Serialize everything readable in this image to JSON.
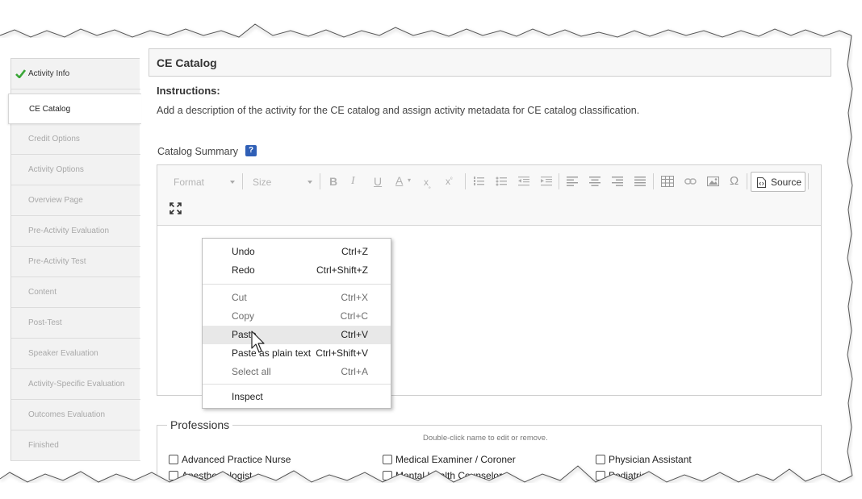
{
  "sidebar": {
    "items": [
      {
        "label": "Activity Info"
      },
      {
        "label": "CE Catalog"
      },
      {
        "label": "Credit Options"
      },
      {
        "label": "Activity Options"
      },
      {
        "label": "Overview Page"
      },
      {
        "label": "Pre-Activity Evaluation"
      },
      {
        "label": "Pre-Activity Test"
      },
      {
        "label": "Content"
      },
      {
        "label": "Post-Test"
      },
      {
        "label": "Speaker Evaluation"
      },
      {
        "label": "Activity-Specific Evaluation"
      },
      {
        "label": "Outcomes Evaluation"
      },
      {
        "label": "Finished"
      }
    ]
  },
  "main": {
    "title": "CE Catalog",
    "instructions_label": "Instructions:",
    "instructions_text": "Add a description of the activity for the CE catalog and assign activity metadata for CE catalog classification.",
    "summary_label": "Catalog Summary",
    "help_icon": "?"
  },
  "toolbar": {
    "format_label": "Format",
    "size_label": "Size",
    "source_label": "Source"
  },
  "context_menu": {
    "items": [
      {
        "label": "Undo",
        "shortcut": "Ctrl+Z"
      },
      {
        "label": "Redo",
        "shortcut": "Ctrl+Shift+Z"
      },
      {
        "label": "Cut",
        "shortcut": "Ctrl+X"
      },
      {
        "label": "Copy",
        "shortcut": "Ctrl+C"
      },
      {
        "label": "Paste",
        "shortcut": "Ctrl+V"
      },
      {
        "label": "Paste as plain text",
        "shortcut": "Ctrl+Shift+V"
      },
      {
        "label": "Select all",
        "shortcut": "Ctrl+A"
      },
      {
        "label": "Inspect",
        "shortcut": ""
      }
    ]
  },
  "professions": {
    "title": "Professions",
    "hint": "Double-click name to edit or remove.",
    "items": [
      "Advanced Practice Nurse",
      "Medical Examiner / Coroner",
      "Physician Assistant",
      "Anesthesiologist",
      "Mental Health Counselor",
      "Podiatrist"
    ]
  },
  "colors": {
    "accent": "#2f5fb6",
    "check": "#3aa637"
  }
}
